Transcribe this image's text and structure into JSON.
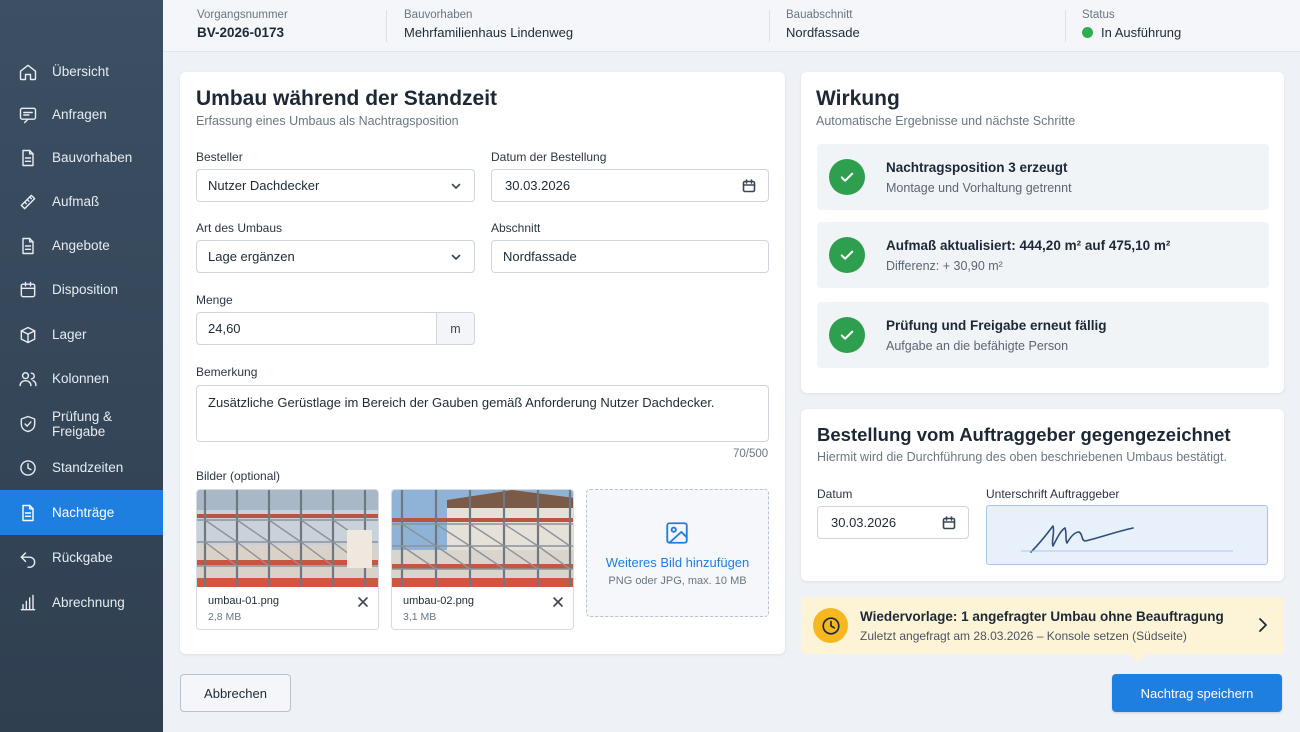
{
  "colors": {
    "accent": "#1f7fe0",
    "success": "#2e9f4e",
    "warning": "#f5b820",
    "sidebar": "#3c4f63"
  },
  "sidebar": {
    "items": [
      {
        "label": "Übersicht",
        "icon": "home-icon",
        "active": false
      },
      {
        "label": "Anfragen",
        "icon": "chat-icon",
        "active": false
      },
      {
        "label": "Bauvorhaben",
        "icon": "document-icon",
        "active": false
      },
      {
        "label": "Aufmaß",
        "icon": "ruler-icon",
        "active": false
      },
      {
        "label": "Angebote",
        "icon": "document-icon",
        "active": false
      },
      {
        "label": "Disposition",
        "icon": "calendar-icon",
        "active": false
      },
      {
        "label": "Lager",
        "icon": "box-icon",
        "active": false
      },
      {
        "label": "Kolonnen",
        "icon": "users-icon",
        "active": false
      },
      {
        "label": "Prüfung & Freigabe",
        "icon": "shield-check-icon",
        "active": false
      },
      {
        "label": "Standzeiten",
        "icon": "clock-icon",
        "active": false
      },
      {
        "label": "Nachträge",
        "icon": "document-icon",
        "active": true
      },
      {
        "label": "Rückgabe",
        "icon": "return-arrow-icon",
        "active": false
      },
      {
        "label": "Abrechnung",
        "icon": "bar-chart-icon",
        "active": false
      }
    ]
  },
  "header": {
    "vorgang": {
      "label": "Vorgangsnummer",
      "value": "BV-2026-0173"
    },
    "bauvorhaben": {
      "label": "Bauvorhaben",
      "value": "Mehrfamilienhaus Lindenweg"
    },
    "bauabschnitt": {
      "label": "Bauabschnitt",
      "value": "Nordfassade"
    },
    "status": {
      "label": "Status",
      "value": "In Ausführung"
    }
  },
  "form": {
    "title": "Umbau während der Standzeit",
    "subtitle": "Erfassung eines Umbaus als Nachtragsposition",
    "besteller": {
      "label": "Besteller",
      "value": "Nutzer Dachdecker"
    },
    "datum": {
      "label": "Datum der Bestellung",
      "value": "30.03.2026"
    },
    "art": {
      "label": "Art des Umbaus",
      "value": "Lage ergänzen"
    },
    "abschnitt": {
      "label": "Abschnitt",
      "value": "Nordfassade"
    },
    "menge": {
      "label": "Menge",
      "value": "24,60",
      "unit": "m"
    },
    "bemerkung": {
      "label": "Bemerkung",
      "value": "Zusätzliche Gerüstlage im Bereich der Gauben gemäß Anforderung Nutzer Dachdecker.",
      "counter": "70/500"
    },
    "bilder": {
      "label": "Bilder (optional)",
      "files": [
        {
          "name": "umbau-01.png",
          "size": "2,8 MB"
        },
        {
          "name": "umbau-02.png",
          "size": "3,1 MB"
        }
      ],
      "upload_title": "Weiteres Bild hinzufügen",
      "upload_hint": "PNG oder JPG, max. 10 MB"
    }
  },
  "wirkung": {
    "title": "Wirkung",
    "subtitle": "Automatische Ergebnisse und nächste Schritte",
    "items": [
      {
        "title": "Nachtragsposition 3 erzeugt",
        "text": "Montage und Vorhaltung getrennt"
      },
      {
        "title": "Aufmaß aktualisiert: 444,20 m² auf 475,10 m²",
        "text": "Differenz: + 30,90 m²"
      },
      {
        "title": "Prüfung und Freigabe erneut fällig",
        "text": "Aufgabe an die befähigte Person"
      }
    ]
  },
  "bestellung": {
    "title": "Bestellung vom Auftraggeber gegengezeichnet",
    "subtitle": "Hiermit wird die Durchführung des oben beschriebenen Umbaus bestätigt.",
    "datum": {
      "label": "Datum",
      "value": "30.03.2026"
    },
    "unterschrift": {
      "label": "Unterschrift Auftraggeber"
    }
  },
  "reminder": {
    "title": "Wiedervorlage: 1 angefragter Umbau ohne Beauftragung",
    "text": "Zuletzt angefragt am 28.03.2026 – Konsole setzen (Südseite)"
  },
  "actions": {
    "cancel": "Abbrechen",
    "save": "Nachtrag speichern"
  }
}
